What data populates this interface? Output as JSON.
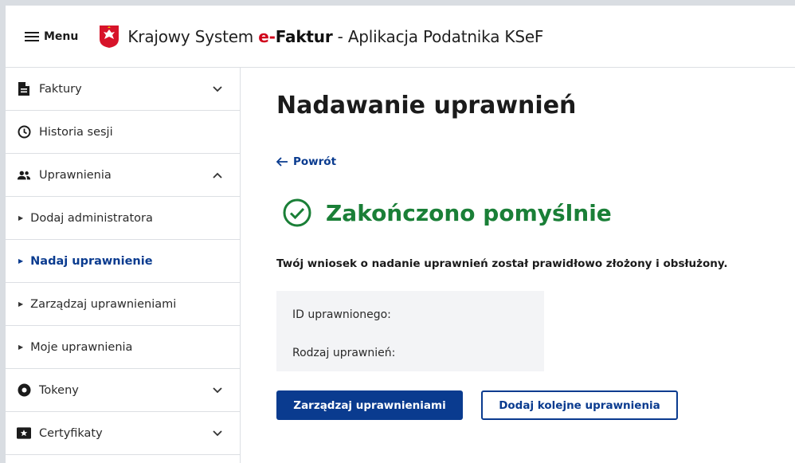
{
  "header": {
    "menu_label": "Menu",
    "title_prefix": "Krajowy System ",
    "title_e": "e-",
    "title_faktur": "Faktur",
    "title_suffix": " - Aplikacja Podatnika KSeF"
  },
  "sidebar": {
    "items": [
      {
        "label": "Faktury",
        "icon": "document-icon",
        "chevron": "down"
      },
      {
        "label": "Historia sesji",
        "icon": "clock-icon"
      },
      {
        "label": "Uprawnienia",
        "icon": "users-icon",
        "chevron": "up"
      },
      {
        "label": "Dodaj administratora"
      },
      {
        "label": "Nadaj uprawnienie",
        "active": true
      },
      {
        "label": "Zarządzaj uprawnieniami"
      },
      {
        "label": "Moje uprawnienia"
      },
      {
        "label": "Tokeny",
        "icon": "token-icon",
        "chevron": "down"
      },
      {
        "label": "Certyfikaty",
        "icon": "certificate-icon",
        "chevron": "down"
      }
    ]
  },
  "main": {
    "title": "Nadawanie uprawnień",
    "back_label": "Powrót",
    "success_label": "Zakończono pomyślnie",
    "message": "Twój wniosek o nadanie uprawnień został prawidłowo złożony i obsłużony.",
    "info": {
      "id_label": "ID uprawnionego:",
      "type_label": "Rodzaj uprawnień:"
    },
    "primary_button": "Zarządzaj uprawnieniami",
    "secondary_button": "Dodaj kolejne uprawnienia"
  },
  "colors": {
    "primary": "#0a3b8f",
    "success": "#1a7f37",
    "brand_red": "#d0021b"
  }
}
